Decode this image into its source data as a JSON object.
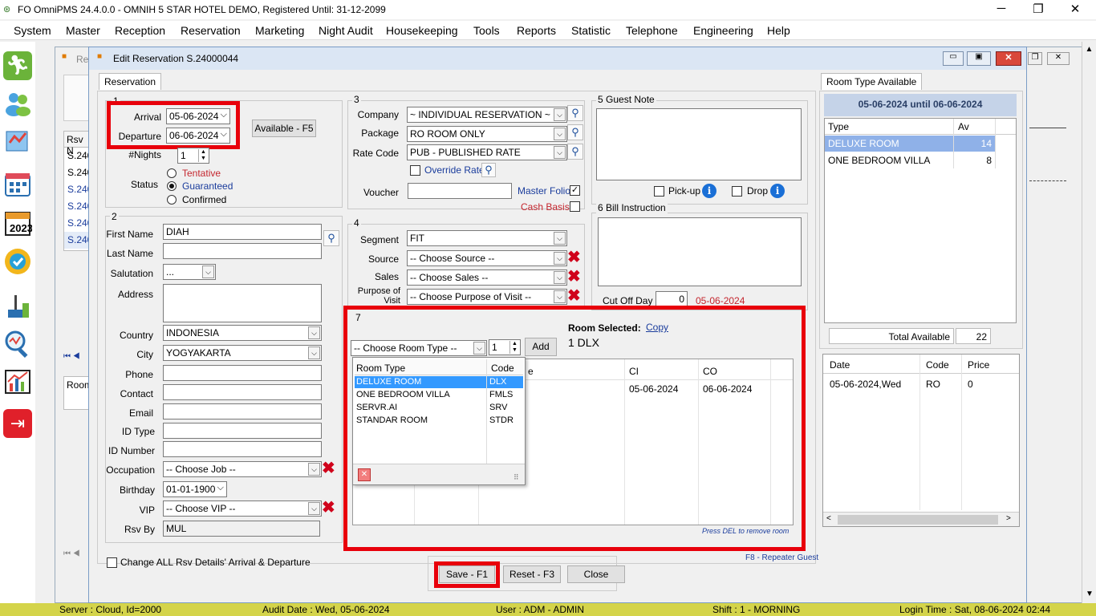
{
  "window": {
    "title": "FO OmniPMS 24.4.0.0 - OMNIH 5 STAR HOTEL DEMO, Registered Until: 31-12-2099",
    "minimize": "─",
    "restore": "❐",
    "close": "✕"
  },
  "menu": [
    "System",
    "Master",
    "Reception",
    "Reservation",
    "Marketing",
    "Night Audit",
    "Housekeeping",
    "Tools",
    "Reports",
    "Statistic",
    "Telephone",
    "Engineering",
    "Help"
  ],
  "bg_window": {
    "title": "Re",
    "list_header": "Rsv N",
    "rows": [
      "S.240",
      "S.240",
      "S.240",
      "S.240",
      "S.240",
      "S.240"
    ],
    "room_header": "Room"
  },
  "dialog": {
    "title": "Edit Reservation S.24000044",
    "tab": "Reservation"
  },
  "sec1": {
    "num": "1",
    "arrival_label": "Arrival",
    "arrival": "05-06-2024",
    "departure_label": "Departure",
    "departure": "06-06-2024",
    "available_button": "Available - F5",
    "nights_label": "#Nights",
    "nights": "1",
    "status_label": "Status",
    "status_options": [
      "Tentative",
      "Guaranteed",
      "Confirmed"
    ],
    "status_selected": "Guaranteed"
  },
  "sec2": {
    "num": "2",
    "first_name_label": "First Name",
    "first_name": "DIAH",
    "last_name_label": "Last Name",
    "last_name": "",
    "salutation_label": "Salutation",
    "salutation": "...",
    "address_label": "Address",
    "country_label": "Country",
    "country": "INDONESIA",
    "city_label": "City",
    "city": "YOGYAKARTA",
    "phone_label": "Phone",
    "contact_label": "Contact",
    "email_label": "Email",
    "id_type_label": "ID Type",
    "id_number_label": "ID Number",
    "occupation_label": "Occupation",
    "occupation": "-- Choose Job --",
    "birthday_label": "Birthday",
    "birthday": "01-01-1900",
    "vip_label": "VIP",
    "vip": "-- Choose VIP --",
    "rsv_by_label": "Rsv By",
    "rsv_by": "MUL"
  },
  "sec3": {
    "num": "3",
    "company_label": "Company",
    "company": "~ INDIVIDUAL RESERVATION ~",
    "package_label": "Package",
    "package": "RO ROOM ONLY",
    "rate_code_label": "Rate Code",
    "rate_code": "PUB - PUBLISHED RATE",
    "override_rate": "Override Rate",
    "voucher_label": "Voucher",
    "master_folio": "Master Folio",
    "cash_basis": "Cash Basis"
  },
  "sec4": {
    "num": "4",
    "segment_label": "Segment",
    "segment": "FIT",
    "source_label": "Source",
    "source": "-- Choose Source --",
    "sales_label": "Sales",
    "sales": "-- Choose Sales --",
    "purpose_label": "Purpose of Visit",
    "purpose": "-- Choose Purpose of Visit --"
  },
  "sec5": {
    "title": "5 Guest Note",
    "pickup": "Pick-up",
    "drop": "Drop"
  },
  "sec6": {
    "title": "6 Bill Instruction",
    "cutoff_label": "Cut Off Day",
    "cutoff": "0",
    "cutoff_date": "05-06-2024"
  },
  "sec7": {
    "num": "7",
    "room_selected_label": "Room Selected:",
    "copy_link": "Copy",
    "room_selected_value": "1 DLX",
    "room_type_combo": "-- Choose Room Type --",
    "qty": "1",
    "add_button": "Add",
    "grid_headers": [
      "",
      "e",
      "CI",
      "CO"
    ],
    "grid_row": {
      "ci": "05-06-2024",
      "co": "06-06-2024"
    },
    "hint": "Press DEL to remove room",
    "dropdown": {
      "headers": [
        "Room Type",
        "Code"
      ],
      "rows": [
        [
          "DELUXE ROOM",
          "DLX"
        ],
        [
          "ONE BEDROOM VILLA",
          "FMLS"
        ],
        [
          "SERVR.AI",
          "SRV"
        ],
        [
          "STANDAR ROOM",
          "STDR"
        ]
      ]
    }
  },
  "room_avail": {
    "tab": "Room Type Available",
    "period": "05-06-2024 until 06-06-2024",
    "headers": [
      "Type",
      "Av"
    ],
    "rows": [
      [
        "DELUXE ROOM",
        "14"
      ],
      [
        "ONE BEDROOM VILLA",
        "8"
      ]
    ],
    "total_label": "Total Available",
    "total": "22"
  },
  "price_grid": {
    "headers": [
      "Date",
      "Code",
      "Price"
    ],
    "rows": [
      [
        "05-06-2024,Wed",
        "RO",
        "0"
      ]
    ]
  },
  "footer": {
    "change_all": "Change ALL Rsv Details' Arrival & Departure",
    "repeater": "F8 - Repeater Guest",
    "save": "Save - F1",
    "reset": "Reset - F3",
    "close": "Close"
  },
  "statusbar": {
    "server": "Server : Cloud, Id=2000",
    "audit": "Audit Date : Wed, 05-06-2024",
    "user": "User : ADM - ADMIN",
    "shift": "Shift : 1 - MORNING",
    "login": "Login Time : Sat, 08-06-2024 02:44"
  },
  "colors": {
    "highlight": "#e8000b",
    "selection": "#3399ff",
    "status_bg": "#d4d44a"
  }
}
